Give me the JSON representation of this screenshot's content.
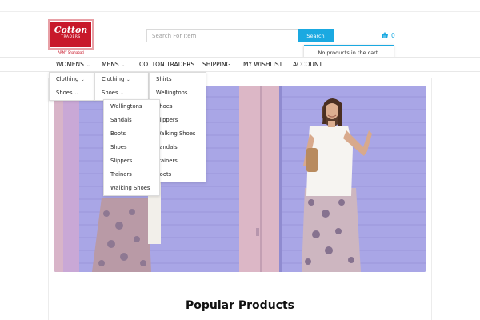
{
  "logo": {
    "brand": "Cotton",
    "sub": "TRADERS",
    "caption": "ARMY Shahabad"
  },
  "search": {
    "placeholder": "Search For Item",
    "button_label": "Search"
  },
  "cart": {
    "icon": "shopping-basket-icon",
    "count": "0",
    "empty_message": "No products in the cart."
  },
  "nav": {
    "items": [
      {
        "label": "WOMENS",
        "has_dropdown": true
      },
      {
        "label": "MENS",
        "has_dropdown": true
      },
      {
        "label": "COTTON TRADERS",
        "has_dropdown": false
      },
      {
        "label": "SHIPPING",
        "has_dropdown": false
      },
      {
        "label": "MY WISHLIST",
        "has_dropdown": false
      },
      {
        "label": "ACCOUNT",
        "has_dropdown": false
      }
    ]
  },
  "menus": {
    "womens": [
      "Clothing",
      "Shoes"
    ],
    "mens": [
      "Clothing",
      "Shoes"
    ],
    "mens_clothing": [
      "Shirts",
      "Wellingtons",
      "Shoes",
      "Slippers",
      "Walking Shoes",
      "Sandals",
      "Trainers",
      "Boots"
    ],
    "shoes_sub": [
      "Wellingtons",
      "Sandals",
      "Boots",
      "Shoes",
      "Slippers",
      "Trainers",
      "Walking Shoes"
    ]
  },
  "colors": {
    "accent": "#1aa9e1",
    "brand": "#c8182a",
    "hero_wall": "#a9a6e6"
  },
  "sections": {
    "popular_title": "Popular Products"
  }
}
